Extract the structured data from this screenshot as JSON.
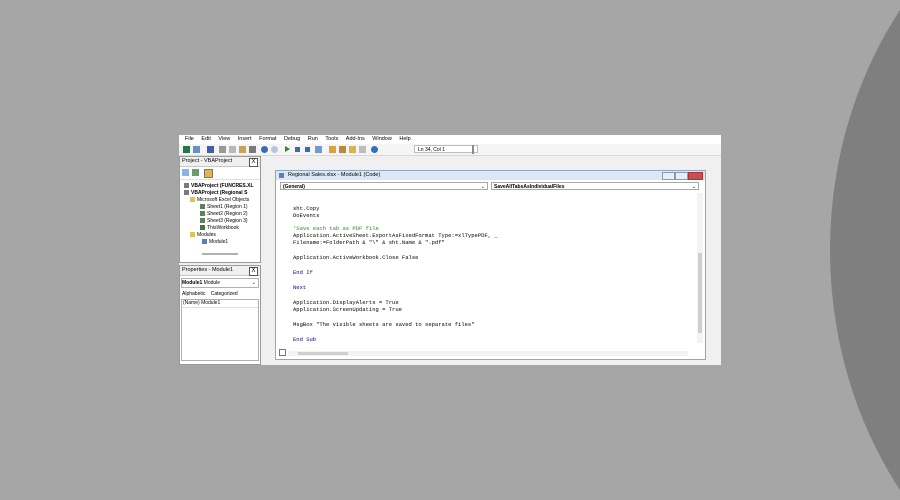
{
  "menu": [
    "File",
    "Edit",
    "View",
    "Insert",
    "Format",
    "Debug",
    "Run",
    "Tools",
    "Add-Ins",
    "Window",
    "Help"
  ],
  "toolbar": {
    "position": "Ln 34, Col 1"
  },
  "project_panel": {
    "title": "Project - VBAProject",
    "close": "X",
    "tree": [
      "VBAProject (FUNCRES.XL",
      "VBAProject (Regional S",
      "Microsoft Excel Objects",
      "Sheet1 (Region 1)",
      "Sheet2 (Region 2)",
      "Sheet3 (Region 3)",
      "ThisWorkbook",
      "Modules",
      "Module1"
    ]
  },
  "properties_panel": {
    "title": "Properties - Module1",
    "close": "X",
    "object": "Module1",
    "object_type": "Module",
    "tabs": [
      "Alphabetic",
      "Categorized"
    ],
    "row_name": "(Name)",
    "row_value": "Module1"
  },
  "code_window": {
    "title": "Regional Sales.xlsx - Module1 (Code)",
    "object_combo": "(General)",
    "proc_combo": "SaveAllTabsAsIndividualFiles",
    "lines": [
      "sht.Copy",
      "DoEvents",
      "'Save each tab as PDF file",
      "Application.ActiveSheet.ExportAsFixedFormat Type:=xlTypePDF, _",
      "Filename:=FolderPath & \"\\\" & sht.Name & \".pdf\"",
      "Application.ActiveWorkbook.Close False",
      "End If",
      "Next",
      "Application.DisplayAlerts = True",
      "Application.ScreenUpdating = True",
      "MsgBox \"The visible sheets are saved to separate files\"",
      "End Sub"
    ]
  },
  "colors": {
    "background": "#a6a6a6",
    "arc": "#7f7f7f",
    "keyword": "#00008b",
    "comment": "#2e8b2e"
  }
}
